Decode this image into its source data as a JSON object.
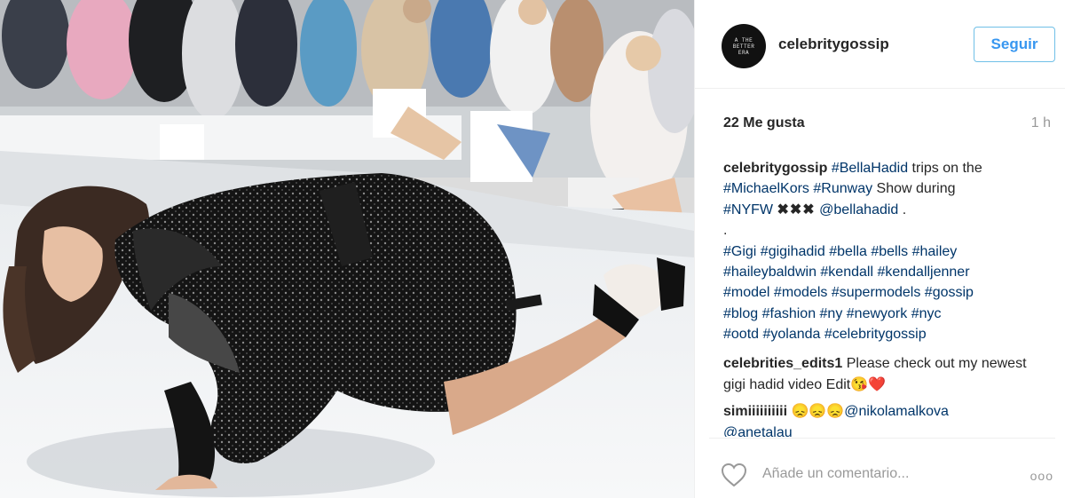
{
  "post": {
    "username": "celebritygossip",
    "avatar_text": "A THE BETTER ERA",
    "follow_label": "Seguir",
    "likes": "22 Me gusta",
    "time_ago": "1 h"
  },
  "caption": {
    "username": "celebritygossip",
    "line1_tag": "#BellaHadid",
    "line1_text": " trips on the",
    "line2_tag1": "#MichaelKors",
    "line2_tag2": "#Runway",
    "line2_text": " Show during",
    "line3_tag1": "#NYFW",
    "line3_marks": "✖✖✖",
    "line3_mention": "@bellahadid",
    "line3_end": " .",
    "dot_line": ".",
    "hashtag_lines": [
      "#Gigi #gigihadid #bella #bells #hailey",
      "#haileybaldwin #kendall #kendalljenner",
      "#model #models #supermodels #gossip",
      "#blog #fashion #ny #newyork #nyc",
      "#ootd #yolanda #celebritygossip"
    ]
  },
  "comments": [
    {
      "username": "celebrities_edits1",
      "text": " Please check out my newest gigi hadid video Edit😘❤️"
    },
    {
      "username": "simiiiiiiiiii",
      "text_emoji": " 😞😞😞",
      "mention1": "@nikolamalkova",
      "mention2": "@anetalau"
    }
  ],
  "comment_box": {
    "placeholder": "Añade un comentario...",
    "more_label": "ooo"
  },
  "colors": {
    "link": "#003569",
    "follow_text": "#3897f0",
    "follow_border": "#70c0e7",
    "muted": "#999999",
    "text": "#262626"
  }
}
